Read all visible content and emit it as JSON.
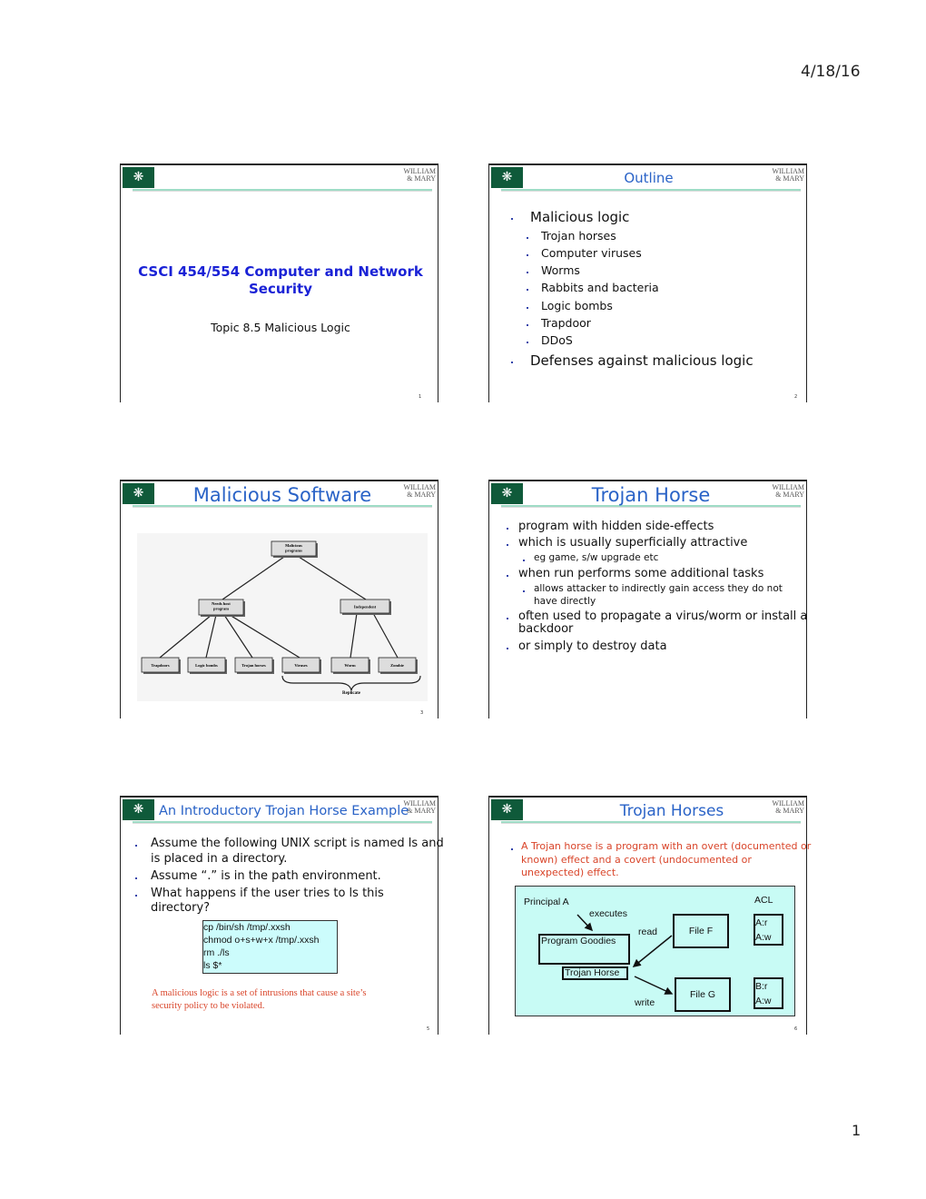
{
  "header": {
    "date": "4/18/16"
  },
  "footer": {
    "page": "1"
  },
  "brand": {
    "logo": "William & Mary cypher",
    "wordmark_line1": "WILLIAM",
    "wordmark_line2": "& MARY",
    "accent": "#2a63c7",
    "rule": "#9fdcc6"
  },
  "slides": [
    {
      "number": "1",
      "title": "CSCI 454/554 Computer and Network Security",
      "subtitle": "Topic 8.5 Malicious Logic"
    },
    {
      "number": "2",
      "title": "Outline",
      "items": [
        {
          "text": "Malicious logic",
          "level": 1
        },
        {
          "text": "Trojan horses",
          "level": 2
        },
        {
          "text": "Computer viruses",
          "level": 2
        },
        {
          "text": "Worms",
          "level": 2
        },
        {
          "text": "Rabbits and bacteria",
          "level": 2
        },
        {
          "text": "Logic bombs",
          "level": 2
        },
        {
          "text": "Trapdoor",
          "level": 2
        },
        {
          "text": "DDoS",
          "level": 2
        },
        {
          "text": "Defenses against malicious logic",
          "level": 1
        }
      ]
    },
    {
      "number": "3",
      "title": "Malicious Software",
      "diagram": {
        "root": "Malicious programs",
        "left": "Needs host program",
        "right": "Independent",
        "leaves": [
          "Trapdoors",
          "Logic bombs",
          "Trojan horses",
          "Viruses",
          "Worm",
          "Zombie"
        ],
        "brace_label": "Replicate"
      }
    },
    {
      "number": "4",
      "title": "Trojan Horse",
      "items": [
        {
          "text": "program with hidden side-effects",
          "level": 1
        },
        {
          "text": "which is usually superficially attractive",
          "level": 1
        },
        {
          "text": "eg game, s/w upgrade etc",
          "level": 2
        },
        {
          "text": "when run performs some additional tasks",
          "level": 1
        },
        {
          "text": "allows attacker to indirectly gain access they do not",
          "level": 2
        },
        {
          "text": "have directly",
          "level": 0
        },
        {
          "text": "often used to propagate a virus/worm or install a",
          "level": 1
        },
        {
          "text": "backdoor",
          "level": 0
        },
        {
          "text": "or simply to destroy data",
          "level": 1
        }
      ]
    },
    {
      "number": "5",
      "title": "An Introductory Trojan Horse Example",
      "items": [
        {
          "text": "Assume the following UNIX script is named ls and",
          "level": 1
        },
        {
          "text": "is placed in a directory.",
          "level": 0
        },
        {
          "text": "Assume “.” is in the path environment.",
          "level": 1
        },
        {
          "text": "What happens if the user tries to ls this",
          "level": 1
        },
        {
          "text": "directory?",
          "level": 0
        }
      ],
      "code": [
        "cp /bin/sh /tmp/.xxsh",
        "chmod o+s+w+x /tmp/.xxsh",
        "rm ./ls",
        "ls $*"
      ],
      "note_line1": "A malicious logic is a set of intrusions that cause a site’s",
      "note_line2": "security policy to be violated."
    },
    {
      "number": "6",
      "title": "Trojan Horses",
      "bullet": [
        "A Trojan horse is a program with an overt (documented or",
        "known) effect and a covert (undocumented or",
        "unexpected) effect."
      ],
      "diagram": {
        "principal": "Principal A",
        "executes": "executes",
        "program": "Program Goodies",
        "trojan": "Trojan Horse",
        "read": "read",
        "write": "write",
        "file_f": "File F",
        "file_g": "File G",
        "acl": "ACL",
        "acl_f": [
          "A:r",
          "A:w"
        ],
        "acl_g": [
          "B:r",
          "A:w"
        ]
      }
    }
  ]
}
